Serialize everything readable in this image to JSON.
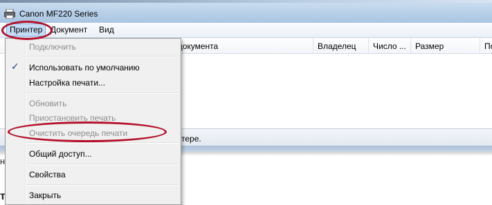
{
  "window": {
    "title": "Canon MF220 Series"
  },
  "menubar": {
    "items": [
      "Принтер",
      "Документ",
      "Вид"
    ]
  },
  "columns": [
    "Имя документа",
    "Владелец",
    "Число ...",
    "Размер",
    "По"
  ],
  "status": {
    "text": "тере."
  },
  "dropdown": {
    "items": [
      {
        "label": "Подключить",
        "enabled": false
      },
      {
        "label": "Использовать по умолчанию",
        "enabled": true,
        "checked": true
      },
      {
        "label": "Настройка печати...",
        "enabled": true
      },
      {
        "label": "Обновить",
        "enabled": false
      },
      {
        "label": "Приостановить печать",
        "enabled": false
      },
      {
        "label": "Очистить очередь печати",
        "enabled": false
      },
      {
        "label": "Общий доступ...",
        "enabled": true
      },
      {
        "label": "Свойства",
        "enabled": true
      },
      {
        "label": "Закрыть",
        "enabled": true
      }
    ]
  },
  "page_fragments": {
    "left_mid": "н",
    "left_bottom": "т"
  },
  "annotation_color": "#b3102a"
}
